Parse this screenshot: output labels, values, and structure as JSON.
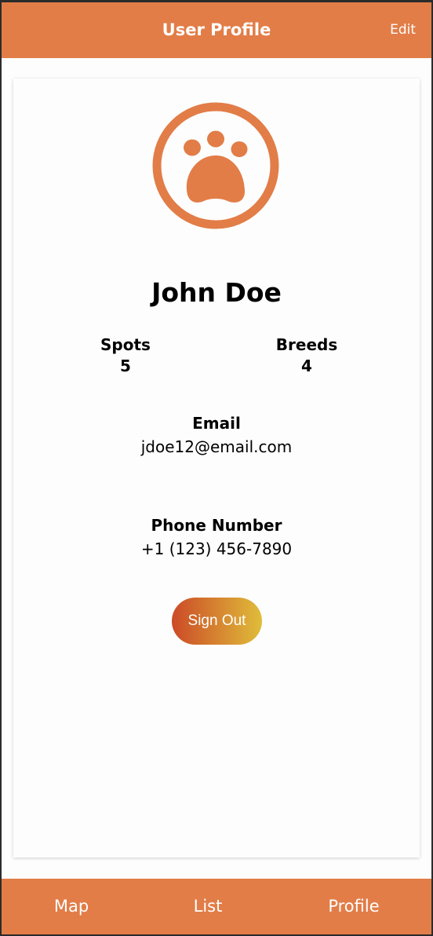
{
  "header": {
    "title": "User Profile",
    "edit_label": "Edit"
  },
  "profile": {
    "avatar_icon": "paw-icon",
    "name": "John Doe",
    "stats": [
      {
        "label": "Spots",
        "value": "5"
      },
      {
        "label": "Breeds",
        "value": "4"
      }
    ],
    "email": {
      "label": "Email",
      "value": "jdoe12@email.com"
    },
    "phone": {
      "label": "Phone Number",
      "value": "+1 (123) 456-7890"
    },
    "sign_out_label": "Sign Out"
  },
  "tabs": [
    {
      "label": "Map"
    },
    {
      "label": "List"
    },
    {
      "label": "Profile"
    }
  ],
  "colors": {
    "accent": "#e27d48",
    "sign_out_gradient_start": "#cc4a27",
    "sign_out_gradient_end": "#dfbd3a"
  }
}
